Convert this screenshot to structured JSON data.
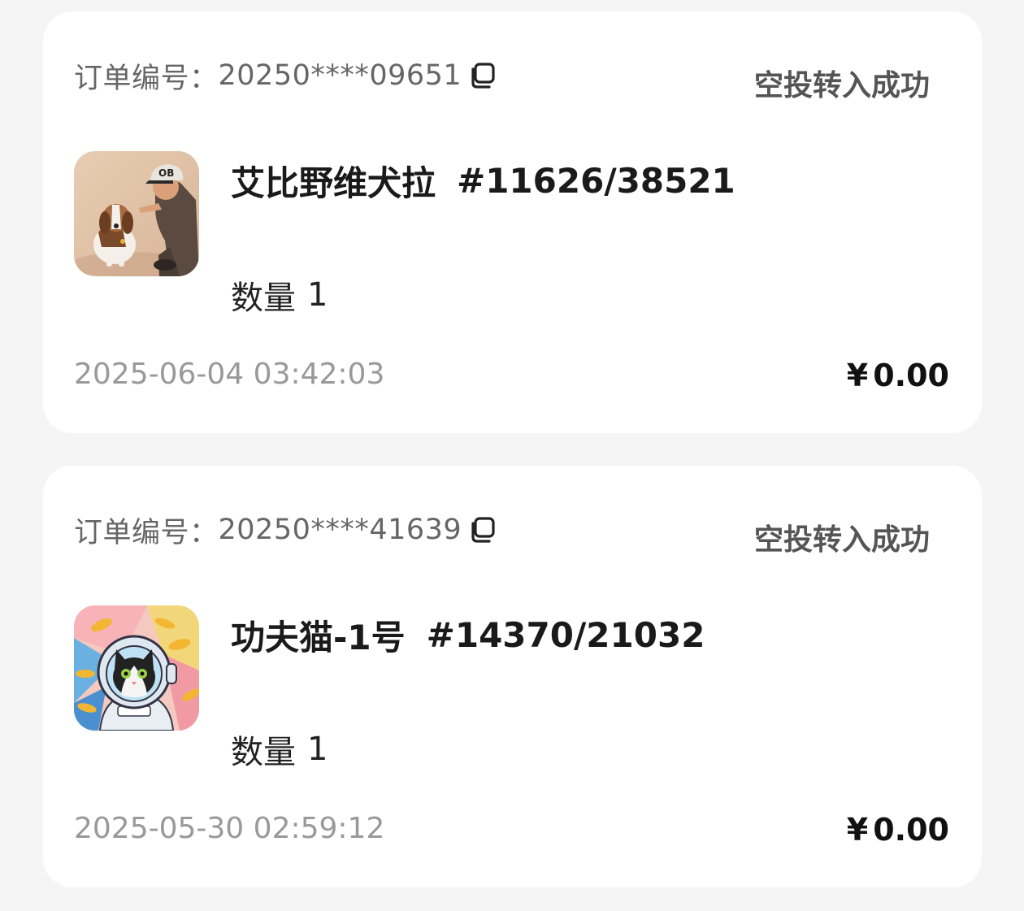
{
  "orders": [
    {
      "order_label": "订单编号：",
      "order_no": "20250****09651",
      "status": "空投转入成功",
      "title": "艾比野维犬拉",
      "serial": "#11626/38521",
      "qty_label": "数量",
      "qty_value": "1",
      "time": "2025-06-04 03:42:03",
      "currency": "¥",
      "amount": "0.00",
      "thumb_icon": "dog-and-man-image",
      "thumb_text": "OB"
    },
    {
      "order_label": "订单编号：",
      "order_no": "20250****41639",
      "status": "空投转入成功",
      "title": "功夫猫-1号",
      "serial": "#14370/21032",
      "qty_label": "数量",
      "qty_value": "1",
      "time": "2025-05-30 02:59:12",
      "currency": "¥",
      "amount": "0.00",
      "thumb_icon": "astronaut-cat-image"
    }
  ],
  "colors": {
    "background": "#f5f5f5",
    "card": "#ffffff",
    "muted_text": "#999999",
    "label_text": "#666666",
    "status_text": "#555555"
  }
}
